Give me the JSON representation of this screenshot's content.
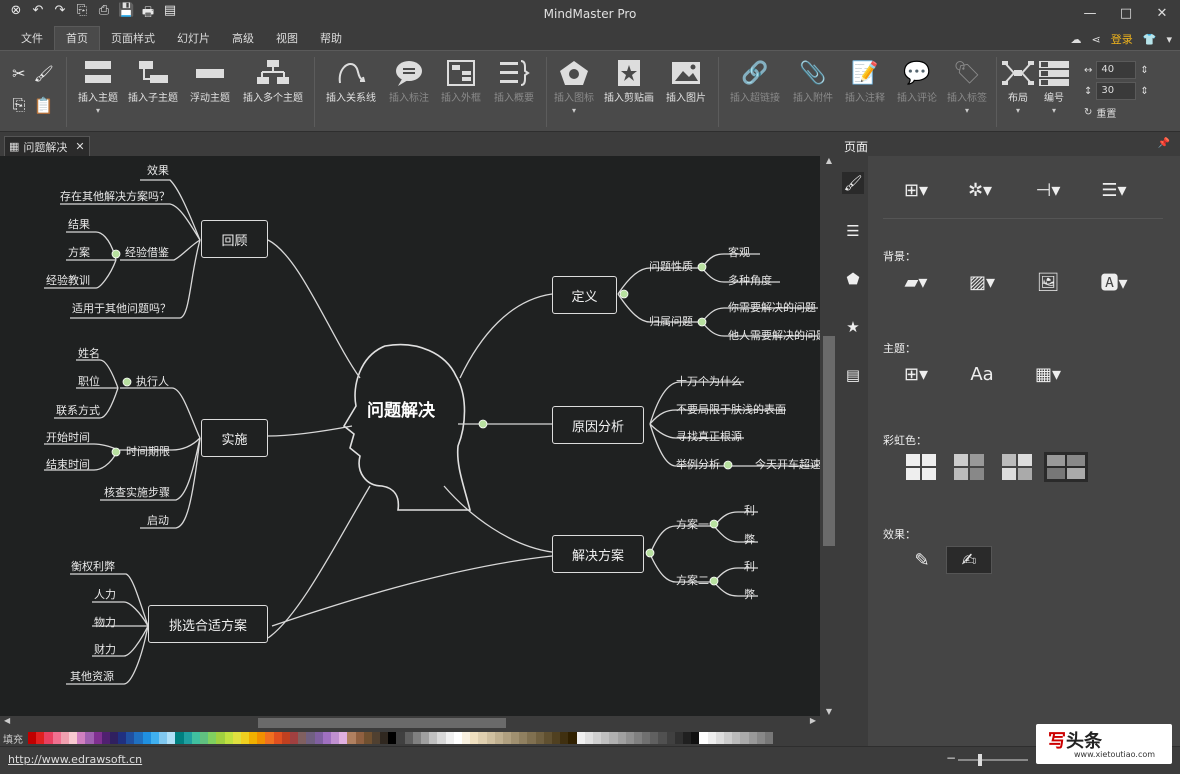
{
  "app": {
    "title": "MindMaster Pro"
  },
  "quick_access": [
    "⊗",
    "↶",
    "↷",
    "⎘",
    "⎙",
    "💾",
    "🖶",
    "▤"
  ],
  "window_controls": {
    "minimize": "—",
    "maximize": "□",
    "close": "✕"
  },
  "menu": {
    "tabs": [
      "文件",
      "首页",
      "页面样式",
      "幻灯片",
      "高级",
      "视图",
      "帮助"
    ],
    "active": "首页",
    "login": "登录"
  },
  "ribbon": {
    "insert_topic": "插入主题",
    "insert_subtopic": "插入子主题",
    "floating_topic": "浮动主题",
    "insert_multi": "插入多个主题",
    "insert_relation": "插入关系线",
    "insert_callout": "插入标注",
    "insert_boundary": "插入外框",
    "insert_summary": "插入概要",
    "insert_icon": "插入图标",
    "insert_clipart": "插入剪贴画",
    "insert_image": "插入图片",
    "insert_hyperlink": "插入超链接",
    "insert_attachment": "插入附件",
    "insert_note": "插入注释",
    "insert_comment": "插入评论",
    "insert_tag": "插入标签",
    "layout": "布局",
    "numbering": "编号",
    "spacing_h": "40",
    "spacing_v": "30",
    "reset": "重置"
  },
  "document_tab": {
    "name": "问题解决",
    "close": "✕"
  },
  "mindmap": {
    "center": "问题解决",
    "review": {
      "label": "回顾",
      "children": [
        "效果",
        "存在其他解决方案吗？",
        "经验借鉴",
        "适用于其他问题吗？"
      ],
      "experience_children": [
        "结果",
        "方案",
        "经验教训"
      ]
    },
    "implement": {
      "label": "实施",
      "children": [
        "执行人",
        "时间期限",
        "核查实施步骤",
        "启动"
      ],
      "executor_children": [
        "姓名",
        "职位",
        "联系方式"
      ],
      "deadline_children": [
        "开始时间",
        "结束时间"
      ]
    },
    "choose": {
      "label": "挑选合适方案",
      "children": [
        "衡权利弊",
        "人力",
        "物力",
        "财力",
        "其他资源"
      ]
    },
    "define": {
      "label": "定义",
      "nature": "问题性质",
      "nature_children": [
        "客观",
        "多种角度"
      ],
      "ownership": "归属问题",
      "ownership_children": [
        "你需要解决的问题",
        "他人需要解决的问题"
      ]
    },
    "cause": {
      "label": "原因分析",
      "children": [
        "十万个为什么",
        "不要局限于肤浅的表面",
        "寻找真正根源",
        "举例分析"
      ],
      "example_child": "今天开车超速"
    },
    "solution": {
      "label": "解决方案",
      "plan1": "方案一",
      "plan2": "方案二",
      "pros": "利",
      "cons": "弊"
    }
  },
  "palette": {
    "label": "填充",
    "colors": [
      "#c00000",
      "#e02020",
      "#e84060",
      "#f07090",
      "#f0a0b0",
      "#f8c8d0",
      "#d080c0",
      "#a060b0",
      "#803090",
      "#502070",
      "#302060",
      "#203080",
      "#2050a0",
      "#2070c0",
      "#2090e0",
      "#40b0f0",
      "#80c8f0",
      "#b0e0f8",
      "#008080",
      "#20a0a0",
      "#40c0a0",
      "#60c080",
      "#80d060",
      "#a0d040",
      "#c0e040",
      "#e0e040",
      "#f0d020",
      "#f0b000",
      "#f09000",
      "#f07020",
      "#e05020",
      "#c04020",
      "#a04040",
      "#806060",
      "#706080",
      "#8060a0",
      "#a070c0",
      "#c090d0",
      "#e0b0e0",
      "#b08060",
      "#906040",
      "#705030",
      "#504030",
      "#302820",
      "#000000",
      "#404040",
      "#606060",
      "#808080",
      "#a0a0a0",
      "#c0c0c0",
      "#d8d8d8",
      "#f0f0f0",
      "#ffffff",
      "#f8f0e0",
      "#f0e0c0",
      "#e0d0b0",
      "#d0c0a0",
      "#c0b090",
      "#b0a080",
      "#a09070",
      "#908060",
      "#807050",
      "#706040",
      "#605030",
      "#504020",
      "#403010",
      "#302000",
      "#f0f0f0",
      "#e0e0e0",
      "#d0d0d0",
      "#c0c0c0",
      "#b0b0b0",
      "#a0a0a0",
      "#909090",
      "#808080",
      "#707070",
      "#606060",
      "#505050",
      "#404040",
      "#303030",
      "#202020",
      "#101010",
      "#ffffff",
      "#eeeeee",
      "#dddddd",
      "#cccccc",
      "#bbbbbb",
      "#aaaaaa",
      "#999999",
      "#888888",
      "#777777"
    ]
  },
  "status": {
    "url": "http://www.edrawsoft.cn"
  },
  "watermark": {
    "brand_red": "写",
    "brand": "头条",
    "sub": "www.xietoutiao.com"
  },
  "panel": {
    "title": "页面",
    "background": "背景：",
    "theme": "主题：",
    "rainbow": "彩虹色：",
    "effect": "效果："
  }
}
